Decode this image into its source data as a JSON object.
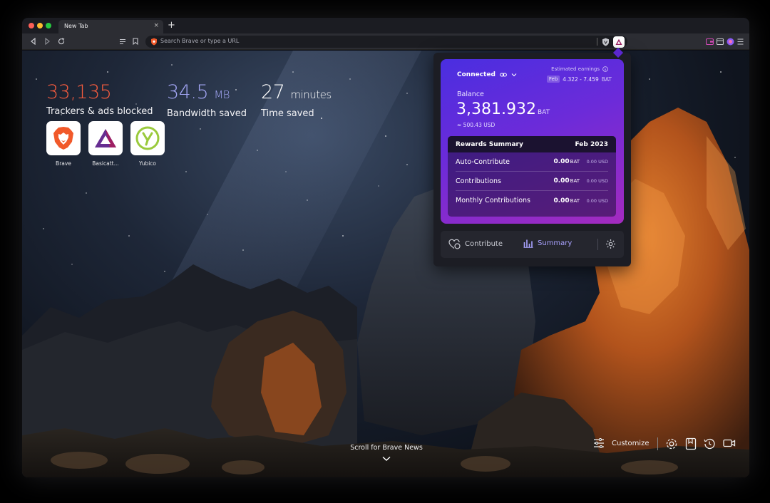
{
  "tab": {
    "title": "New Tab",
    "close": "×",
    "new": "+"
  },
  "urlbar": {
    "placeholder": "Search Brave or type a URL"
  },
  "stats": {
    "trackers": {
      "value": "33,135",
      "label": "Trackers & ads blocked",
      "color": "#f35b3e"
    },
    "bandwidth": {
      "value": "34.5",
      "unit": "MB",
      "label": "Bandwidth saved",
      "color": "#a3a6f5"
    },
    "time": {
      "value": "27",
      "unit": "minutes",
      "label": "Time saved",
      "color": "#ffffff"
    }
  },
  "top_sites": [
    {
      "label": "Brave",
      "icon": "brave-lion-icon"
    },
    {
      "label": "Basicatt...",
      "icon": "bat-triangle-icon"
    },
    {
      "label": "Yubico",
      "icon": "yubico-icon"
    }
  ],
  "rewards": {
    "status": "Connected",
    "estimated_label": "Estimated earnings",
    "estimated_month": "Feb",
    "estimated_range": "4.322 - 7.459",
    "estimated_currency": "BAT",
    "balance_label": "Balance",
    "balance_value": "3,381.932",
    "balance_currency": "BAT",
    "balance_usd": "≈ 500.43 USD",
    "summary_title": "Rewards Summary",
    "summary_period": "Feb 2023",
    "summary_rows": [
      {
        "label": "Auto-Contribute",
        "bat": "0.00",
        "bat_unit": "BAT",
        "usd": "0.00 USD"
      },
      {
        "label": "Contributions",
        "bat": "0.00",
        "bat_unit": "BAT",
        "usd": "0.00 USD"
      },
      {
        "label": "Monthly Contributions",
        "bat": "0.00",
        "bat_unit": "BAT",
        "usd": "0.00 USD"
      }
    ],
    "footer": {
      "contribute": "Contribute",
      "summary": "Summary"
    }
  },
  "bottom": {
    "scroll_news": "Scroll for Brave News",
    "customize": "Customize"
  },
  "colors": {
    "accent": "#6c2bd9",
    "brave_orange": "#f1592a",
    "summary_link": "#a9a2ff"
  }
}
